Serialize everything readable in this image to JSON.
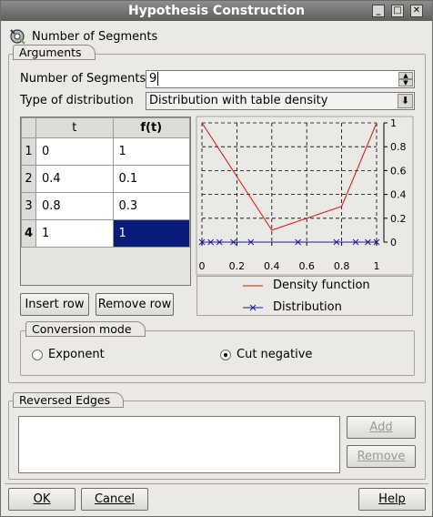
{
  "window": {
    "title": "Hypothesis Construction"
  },
  "header": {
    "label": "Number of Segments"
  },
  "arguments": {
    "group_label": "Arguments",
    "segments_label": "Number of Segments",
    "segments_value": "9",
    "distribution_label": "Type of distribution",
    "distribution_value": "Distribution with table density",
    "table": {
      "columns": [
        "t",
        "f(t)"
      ],
      "rows": [
        {
          "index": "1",
          "t": "0",
          "ft": "1"
        },
        {
          "index": "2",
          "t": "0.4",
          "ft": "0.1"
        },
        {
          "index": "3",
          "t": "0.8",
          "ft": "0.3"
        },
        {
          "index": "4",
          "t": "1",
          "ft": "1"
        }
      ]
    },
    "insert_row": "Insert row",
    "remove_row": "Remove row"
  },
  "chart_data": {
    "type": "line",
    "x_ticks": [
      "0",
      "0.2",
      "0.4",
      "0.6",
      "0.8",
      "1"
    ],
    "y_ticks": [
      "1",
      "0.8",
      "0.6",
      "0.4",
      "0.2",
      "0"
    ],
    "xlim": [
      0,
      1
    ],
    "ylim": [
      0,
      1
    ],
    "grid": true,
    "series": [
      {
        "name": "Density function",
        "color": "#dd1111",
        "x": [
          0,
          0.4,
          0.8,
          1
        ],
        "y": [
          1,
          0.1,
          0.3,
          1
        ]
      },
      {
        "name": "Distribution",
        "color": "#1a1aa6",
        "x": [
          0,
          0.05,
          0.1,
          0.18,
          0.28,
          0.55,
          0.77,
          0.88,
          0.95,
          1
        ],
        "y": [
          0,
          0,
          0,
          0,
          0,
          0,
          0,
          0,
          0,
          0
        ]
      }
    ]
  },
  "conversion": {
    "group_label": "Conversion mode",
    "options": [
      {
        "label": "Exponent",
        "checked": false
      },
      {
        "label": "Cut negative",
        "checked": true
      }
    ]
  },
  "reversed_edges": {
    "group_label": "Reversed Edges",
    "add": "Add",
    "remove": "Remove"
  },
  "footer": {
    "ok": "OK",
    "cancel": "Cancel",
    "help": "Help"
  }
}
